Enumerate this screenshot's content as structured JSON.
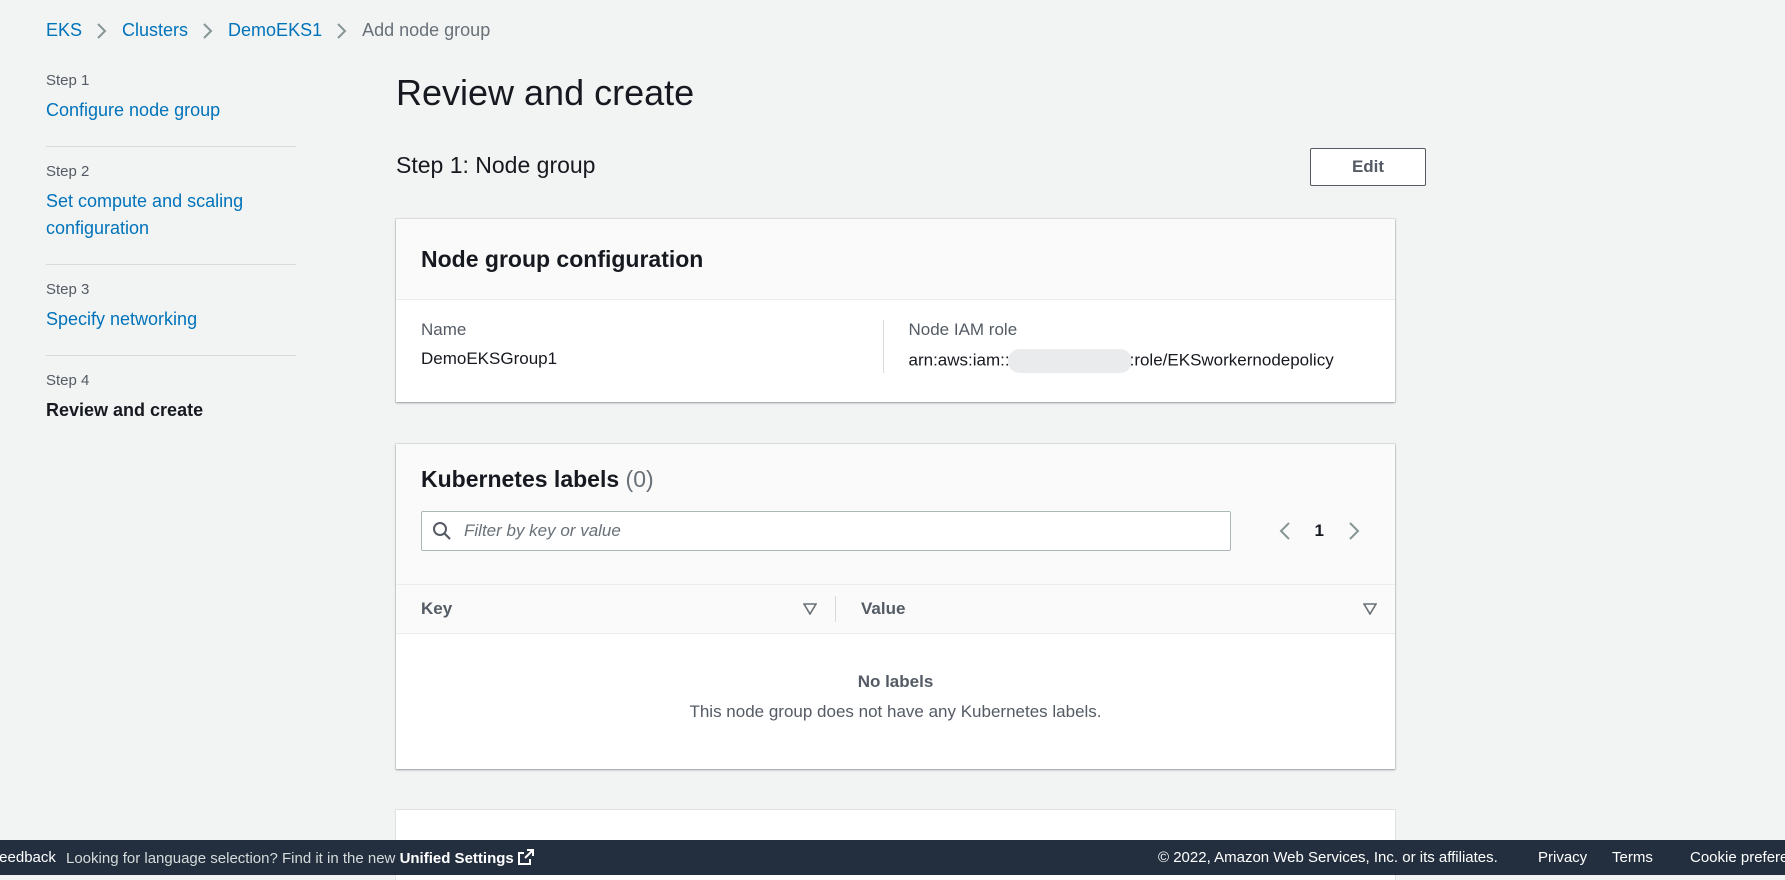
{
  "breadcrumb": {
    "items": [
      "EKS",
      "Clusters",
      "DemoEKS1"
    ],
    "current": "Add node group"
  },
  "sidenav": {
    "steps": [
      {
        "num": "Step 1",
        "label": "Configure node group"
      },
      {
        "num": "Step 2",
        "label": "Set compute and scaling configuration"
      },
      {
        "num": "Step 3",
        "label": "Specify networking"
      },
      {
        "num": "Step 4",
        "label": "Review and create"
      }
    ]
  },
  "main": {
    "title": "Review and create",
    "section_title": "Step 1: Node group",
    "edit_label": "Edit",
    "config": {
      "title": "Node group configuration",
      "name_label": "Name",
      "name_value": "DemoEKSGroup1",
      "role_label": "Node IAM role",
      "role_prefix": "arn:aws:iam::",
      "role_suffix": ":role/EKSworkernodepolicy"
    },
    "labels": {
      "title": "Kubernetes labels",
      "count": "(0)",
      "search_placeholder": "Filter by key or value",
      "page": "1",
      "col_key": "Key",
      "col_value": "Value",
      "empty_title": "No labels",
      "empty_desc": "This node group does not have any Kubernetes labels."
    }
  },
  "footer": {
    "feedback": "Feedback",
    "lang_text": "Looking for language selection? Find it in the new",
    "unified": "Unified Settings",
    "copyright": "© 2022, Amazon Web Services, Inc. or its affiliates.",
    "privacy": "Privacy",
    "terms": "Terms",
    "cookie": "Cookie preferences"
  },
  "icons": {
    "breadcrumb_separator": "chevron-right-icon",
    "search": "search-icon",
    "pager_prev": "chevron-left-icon",
    "pager_next": "chevron-right-icon",
    "sort": "caret-down-icon",
    "external": "external-link-icon"
  },
  "colors": {
    "link": "#0073bb",
    "footer_bg": "#232f3e",
    "page_bg": "#f2f3f3"
  }
}
